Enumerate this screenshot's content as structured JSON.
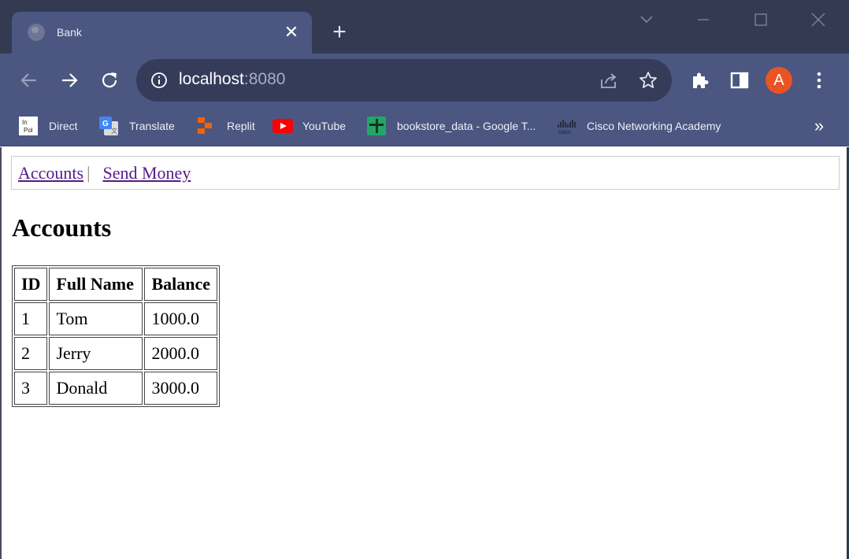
{
  "browser": {
    "tab": {
      "title": "Bank",
      "close_glyph": "✕"
    },
    "new_tab_glyph": "+",
    "address": {
      "host": "localhost",
      "port": ":8080"
    },
    "profile_initial": "A",
    "bookmarks": [
      {
        "label": "Direct",
        "icon": "inpol-icon"
      },
      {
        "label": "Translate",
        "icon": "google-translate-icon"
      },
      {
        "label": "Replit",
        "icon": "replit-icon"
      },
      {
        "label": "YouTube",
        "icon": "youtube-icon"
      },
      {
        "label": "bookstore_data - Google T...",
        "icon": "google-sheets-icon"
      },
      {
        "label": "Cisco Networking Academy",
        "icon": "cisco-icon"
      }
    ],
    "bookmarks_more_glyph": "»",
    "colors": {
      "frame": "#353a53",
      "toolbar": "#4b5780",
      "omnibox": "#353c5a",
      "avatar": "#ec5324"
    }
  },
  "page": {
    "nav": {
      "accounts_link": "Accounts",
      "separator": "|",
      "send_money_link": "Send Money"
    },
    "heading": "Accounts",
    "table": {
      "headers": [
        "ID",
        "Full Name",
        "Balance"
      ],
      "rows": [
        [
          "1",
          "Tom",
          "1000.0"
        ],
        [
          "2",
          "Jerry",
          "2000.0"
        ],
        [
          "3",
          "Donald",
          "3000.0"
        ]
      ]
    }
  }
}
